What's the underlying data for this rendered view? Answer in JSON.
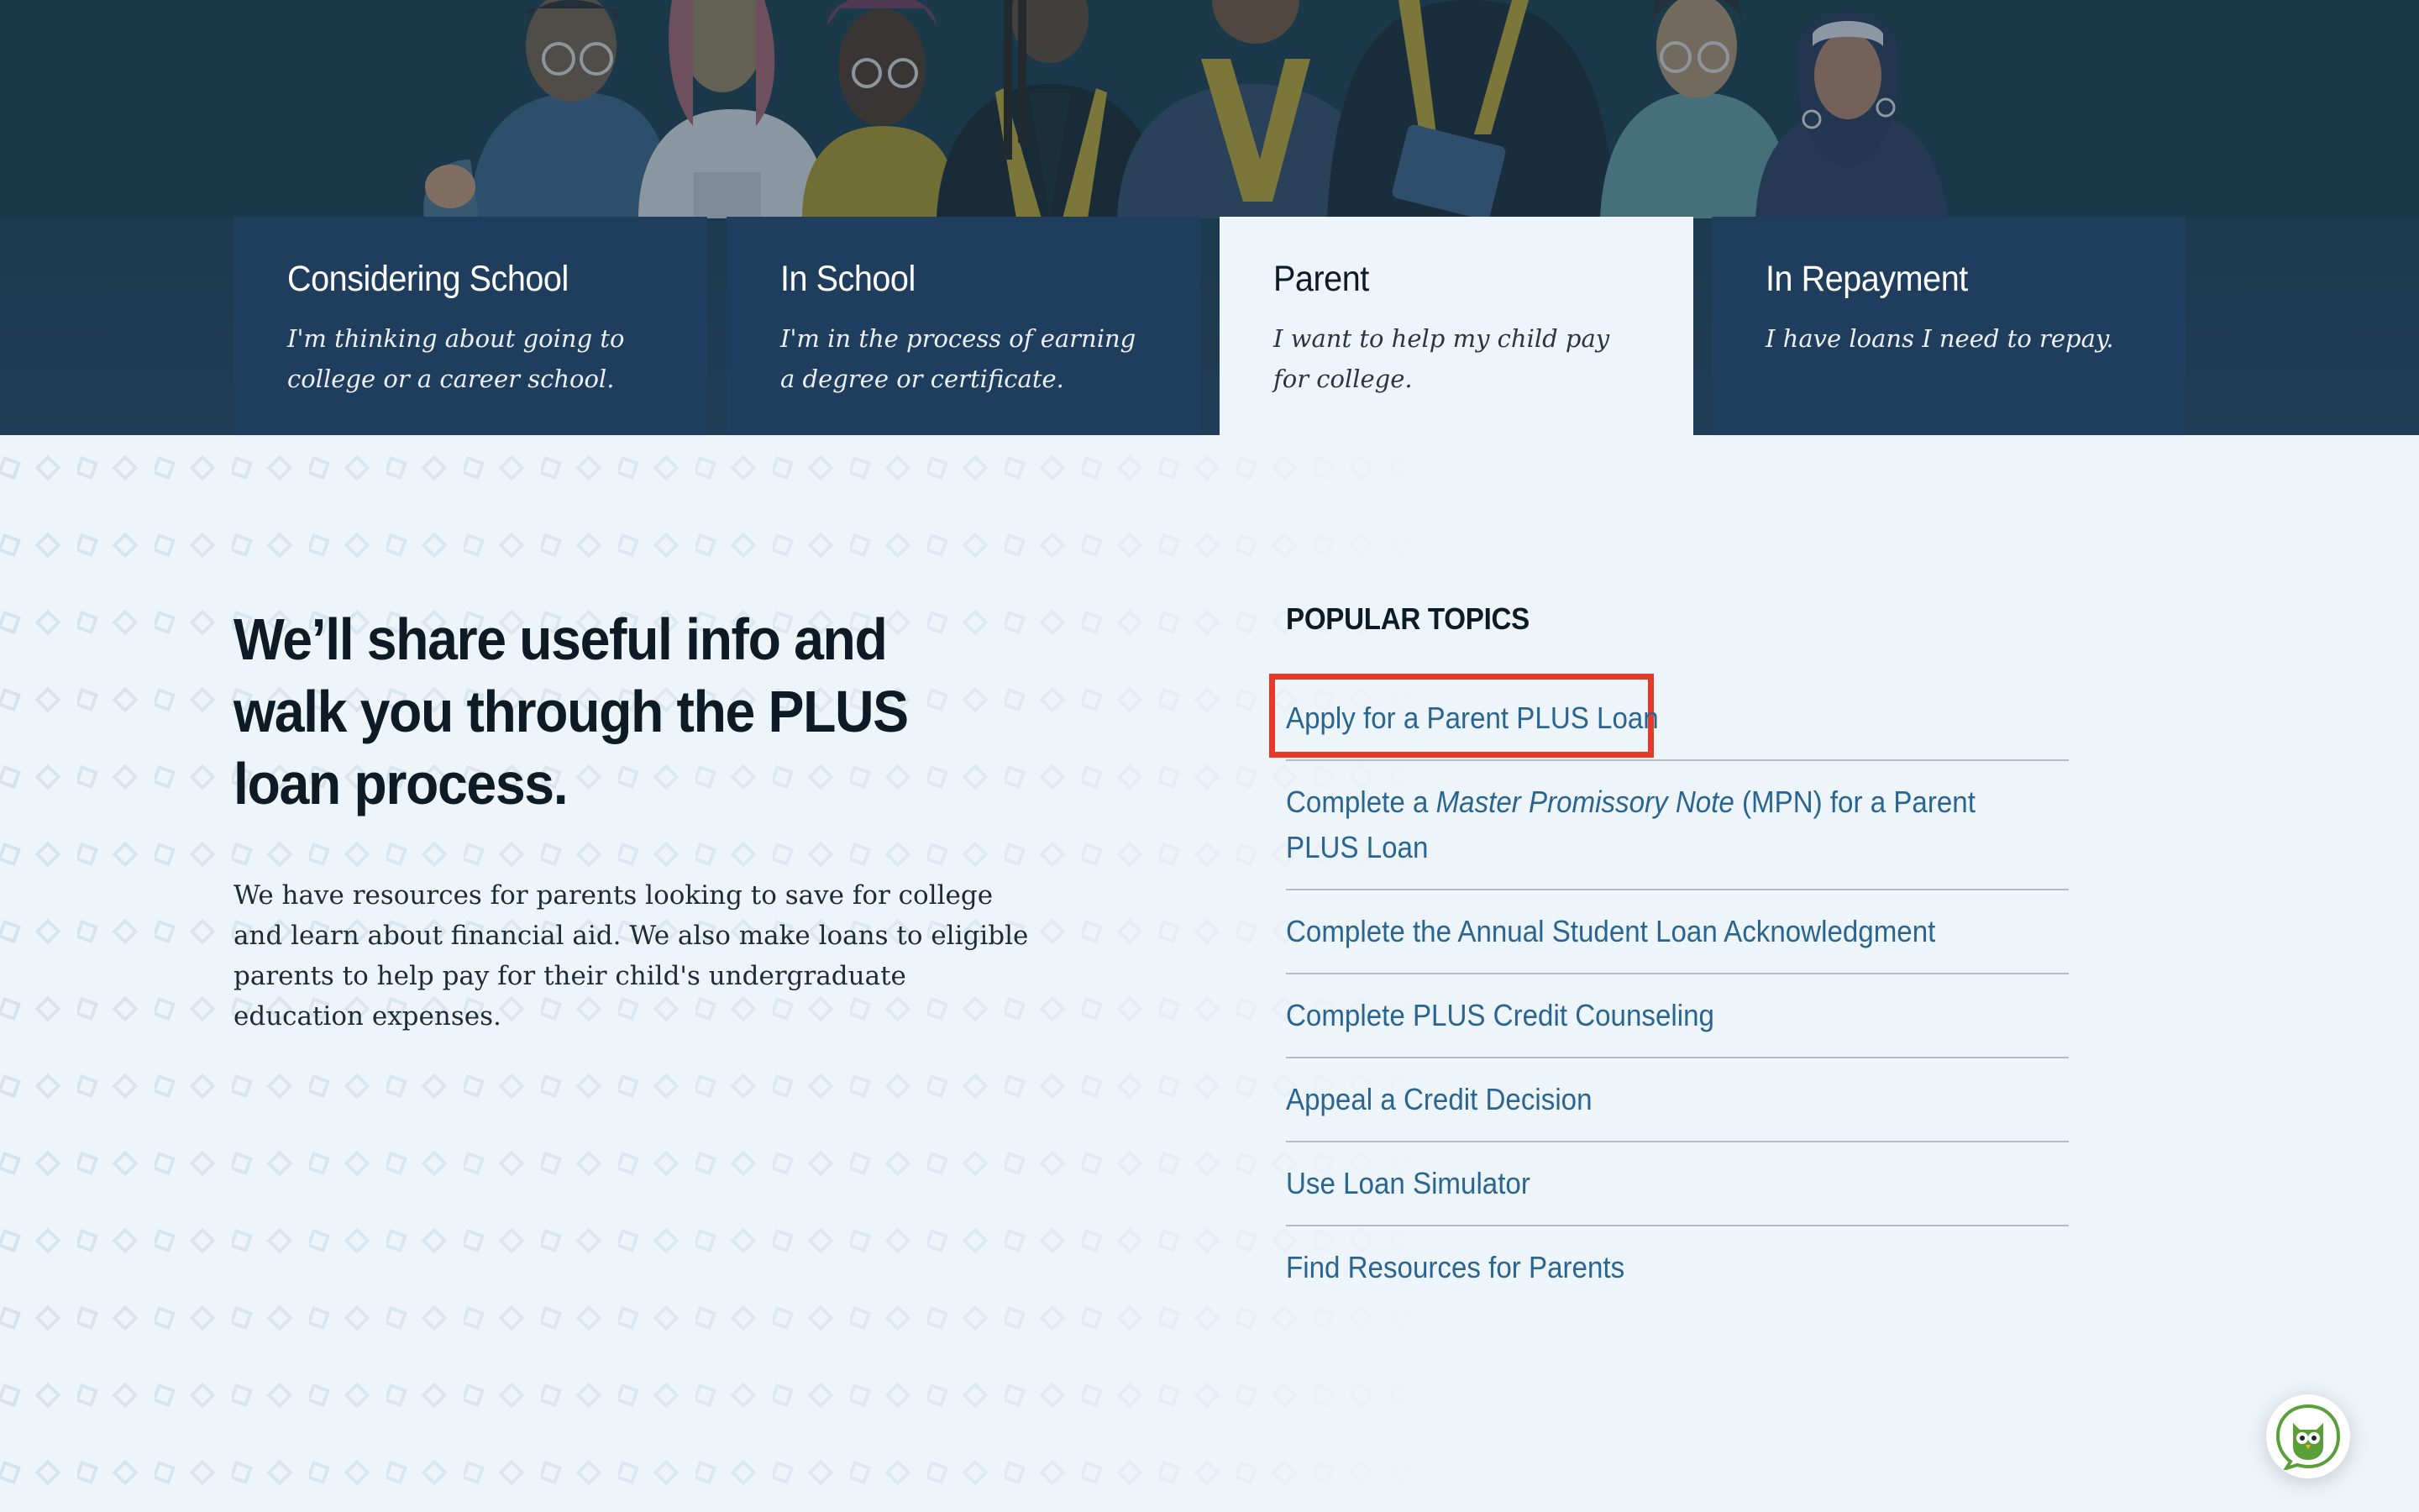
{
  "tabs": [
    {
      "title": "Considering School",
      "desc": "I'm thinking about going to college or a career school.",
      "active": false
    },
    {
      "title": "In School",
      "desc": "I'm in the process of earning a degree or certificate.",
      "active": false
    },
    {
      "title": "Parent",
      "desc": "I want to help my child pay for college.",
      "active": true
    },
    {
      "title": "In Repayment",
      "desc": "I have loans I need to repay.",
      "active": false
    }
  ],
  "intro": {
    "headline": "We’ll share useful info and walk you through the PLUS loan process.",
    "body": "We have resources for parents looking to save for college and learn about financial aid. We also make loans to eligible parents to help pay for their child's undergraduate education expenses."
  },
  "popular_topics": {
    "heading": "POPULAR TOPICS",
    "items": [
      {
        "label": "Apply for a Parent PLUS Loan"
      },
      {
        "label_before": "Complete a ",
        "label_italic": "Master Promissory Note",
        "label_after": " (MPN) for a Parent PLUS Loan"
      },
      {
        "label": "Complete the Annual Student Loan Acknowledgment"
      },
      {
        "label": "Complete PLUS Credit Counseling"
      },
      {
        "label": "Appeal a Credit Decision"
      },
      {
        "label": "Use Loan Simulator"
      },
      {
        "label": "Find Resources for Parents"
      }
    ],
    "highlighted_index": 0
  },
  "chat": {
    "icon": "owl-chat-icon"
  },
  "colors": {
    "hero_bg": "#1d3c4c",
    "tab_bg": "#1f3e5e",
    "page_bg": "#eef5fa",
    "link": "#2a6591",
    "highlight": "#e43a27",
    "owl": "#5a9f38"
  }
}
